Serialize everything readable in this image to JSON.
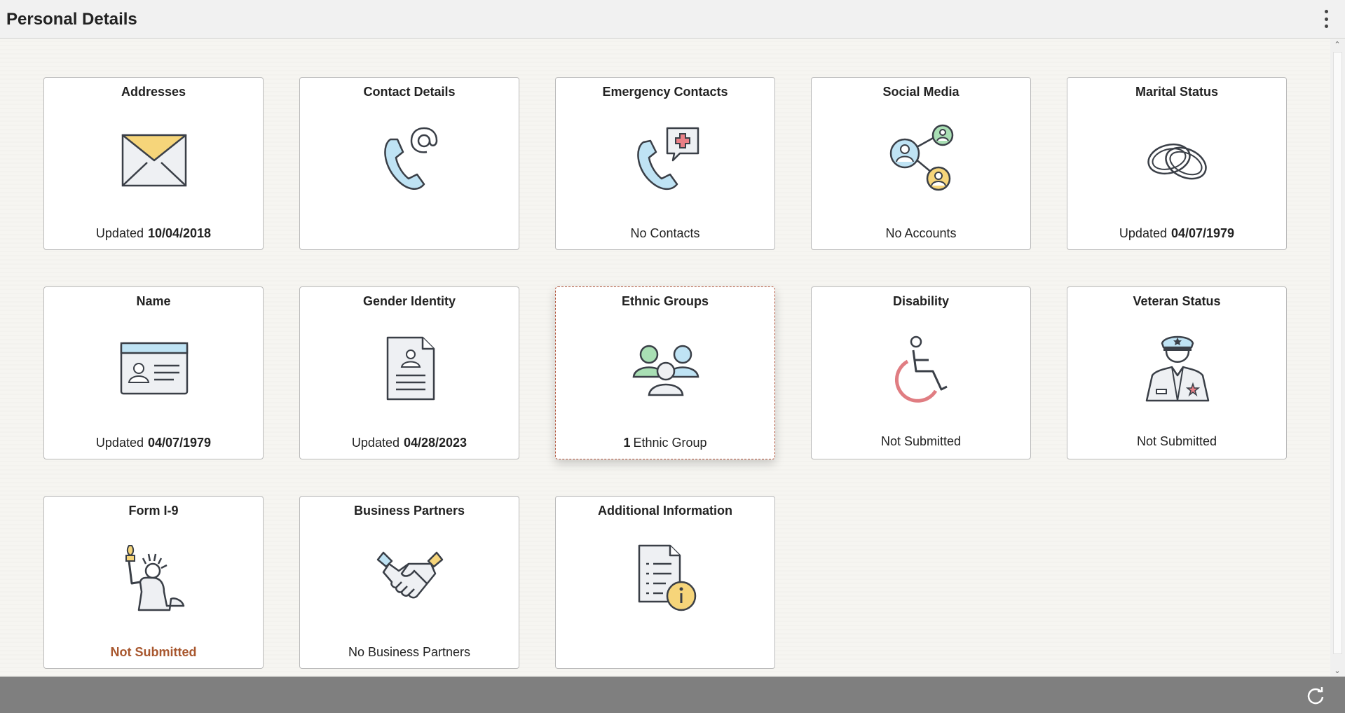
{
  "header": {
    "title": "Personal Details",
    "menu_icon": "kebab-menu-icon"
  },
  "tiles": [
    {
      "title": "Addresses",
      "icon": "envelope-icon",
      "prefix": "Updated",
      "value": "10/04/2018"
    },
    {
      "title": "Contact Details",
      "icon": "phone-at-icon"
    },
    {
      "title": "Emergency Contacts",
      "icon": "phone-medical-icon",
      "status": "No Contacts"
    },
    {
      "title": "Social Media",
      "icon": "social-network-icon",
      "status": "No Accounts"
    },
    {
      "title": "Marital Status",
      "icon": "wedding-rings-icon",
      "prefix": "Updated",
      "value": "04/07/1979"
    },
    {
      "title": "Name",
      "icon": "id-card-icon",
      "prefix": "Updated",
      "value": "04/07/1979"
    },
    {
      "title": "Gender Identity",
      "icon": "profile-document-icon",
      "prefix": "Updated",
      "value": "04/28/2023"
    },
    {
      "title": "Ethnic Groups",
      "icon": "people-group-icon",
      "count": "1",
      "status": "Ethnic Group"
    },
    {
      "title": "Disability",
      "icon": "wheelchair-icon",
      "status": "Not Submitted"
    },
    {
      "title": "Veteran Status",
      "icon": "veteran-officer-icon",
      "status": "Not Submitted"
    },
    {
      "title": "Form I-9",
      "icon": "statue-of-liberty-icon",
      "status": "Not Submitted"
    },
    {
      "title": "Business Partners",
      "icon": "handshake-icon",
      "status": "No Business Partners"
    },
    {
      "title": "Additional Information",
      "icon": "document-info-icon"
    }
  ],
  "colors": {
    "warning_text": "#a8572e",
    "focus_border": "#b0533a",
    "footer_bg": "#7f7f7f"
  },
  "footer": {
    "refresh_icon": "refresh-icon"
  }
}
